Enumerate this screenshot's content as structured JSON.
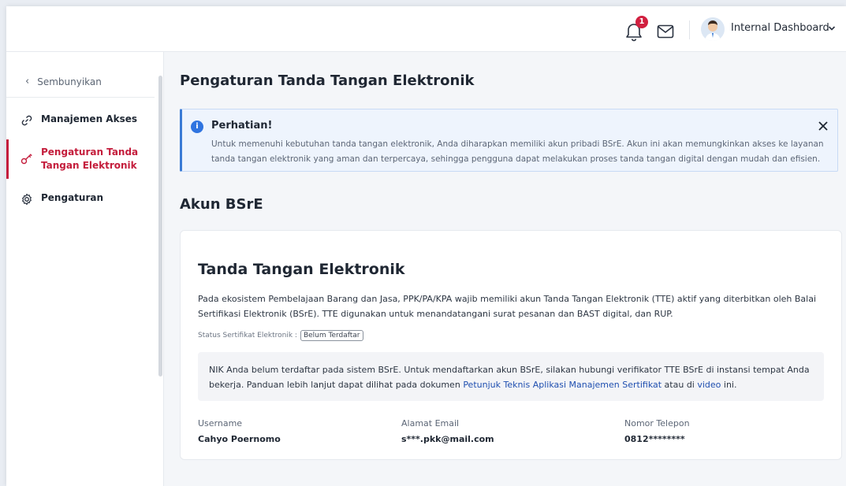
{
  "header": {
    "notification_count": "1",
    "user_label": "Internal Dashboard"
  },
  "sidebar": {
    "hide_label": "Sembunyikan",
    "items": [
      {
        "label": "Manajemen Akses"
      },
      {
        "label_line1": "Pengaturan Tanda",
        "label_line2": "Tangan Elektronik",
        "active": true
      },
      {
        "label": "Pengaturan"
      }
    ]
  },
  "main": {
    "page_title": "Pengaturan Tanda Tangan Elektronik",
    "alert": {
      "title": "Perhatian!",
      "text": "Untuk memenuhi kebutuhan tanda tangan elektronik, Anda diharapkan memiliki akun pribadi BSrE. Akun ini akan memungkinkan akses ke layanan tanda tangan elektronik yang aman dan terpercaya, sehingga pengguna dapat melakukan proses tanda tangan digital dengan mudah dan efisien."
    },
    "section_title": "Akun BSrE",
    "card": {
      "title": "Tanda Tangan Elektronik",
      "description": "Pada ekosistem Pembelajaan Barang dan Jasa, PPK/PA/KPA wajib memiliki akun Tanda Tangan Elektronik (TTE) aktif yang diterbitkan oleh Balai Sertifikasi Elektronik (BSrE). TTE digunakan untuk menandatangani surat pesanan dan BAST digital, dan RUP.",
      "status_label": "Status Sertifikat Elektronik :",
      "status_value": "Belum Terdaftar",
      "info_text_1": "NIK Anda belum terdaftar pada sistem BSrE. Untuk mendaftarkan akun BSrE, silakan hubungi verifikator TTE BSrE di instansi tempat Anda bekerja. Panduan lebih lanjut dapat dilihat pada dokumen ",
      "info_link_1": "Petunjuk Teknis Aplikasi Manajemen Sertifikat",
      "info_text_2": " atau di ",
      "info_link_2": "video",
      "info_text_3": " ini.",
      "fields": [
        {
          "label": "Username",
          "value": "Cahyo Poernomo"
        },
        {
          "label": "Alamat Email",
          "value": "s***.pkk@mail.com"
        },
        {
          "label": "Nomor Telepon",
          "value": "0812********"
        }
      ]
    }
  },
  "colors": {
    "accent_red": "#c41d3c",
    "info_blue": "#2f74e0",
    "link_blue": "#1f4fb0"
  }
}
